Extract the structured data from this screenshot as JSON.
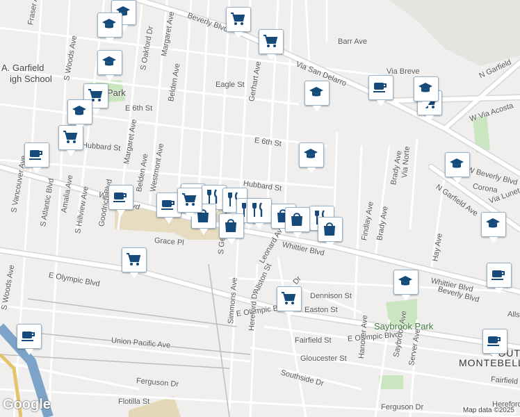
{
  "map": {
    "attribution": "Map data ©2025",
    "logo": "Google",
    "colors": {
      "background": "#f0efee",
      "road": "#ffffff",
      "road_outline": "#d6d6d6",
      "park": "#c9e6c0",
      "school": "#e8dcc0",
      "marker_icon": "#154a7a"
    }
  },
  "streets": [
    "Fraser Ave",
    "S Woods Ave",
    "S Oakford Dr",
    "Margaret Ave",
    "Belden Ave",
    "Gerhart Ave",
    "Beverly Blvd",
    "Barr Ave",
    "Via San Delarro",
    "Via Breve",
    "N Garfield",
    "Eagle St",
    "E 6th St",
    "E 6th St",
    "Hubbard St",
    "Hubbard St",
    "W Via Acosta",
    "Brady Ave",
    "Via Norte",
    "W Beverly Blvd",
    "Corona",
    "N Garfield Ave",
    "Via Luneta",
    "Whittier Blvd",
    "Whittier Blvd",
    "Whittier Blvd",
    "Findlay Ave",
    "Brady Ave",
    "Hay Ave",
    "Grace Pl",
    "Leonard Ave",
    "E Olympic Blvd",
    "E Olympic Blvd",
    "E Olympic Blvd",
    "S Gerhart Ave",
    "Allston St",
    "Dennison St",
    "Easton St",
    "Simmons Ave",
    "Hereford Dr",
    "Union Pacific Ave",
    "Fairfield St",
    "Gloucester St",
    "Southside Dr",
    "Hanover Ave",
    "Saybrook Ave",
    "Server Ave",
    "Ferguson Dr",
    "Ferguson Dr",
    "Flotilla St",
    "S Vancouver Ave",
    "S Atlantic Blvd",
    "Amalia Ave",
    "S Hillview Ave",
    "Goodrich Blvd",
    "Beverly Blvd",
    "Margaret Ave",
    "Belden Ave",
    "Westmont Ave",
    "Fairfield",
    "Hereford Dr",
    "Allston St",
    "S Woods Ave",
    "Dr"
  ],
  "places": [
    "A. Garfield",
    "igh School",
    "Park",
    "Saybrook Park",
    "SOUTH",
    "MONTEBELL"
  ],
  "markers": [
    {
      "icon": "school"
    },
    {
      "icon": "grocery"
    },
    {
      "icon": "school"
    },
    {
      "icon": "grocery"
    },
    {
      "icon": "school"
    },
    {
      "icon": "grocery"
    },
    {
      "icon": "school"
    },
    {
      "icon": "grocery"
    },
    {
      "icon": "cafe"
    },
    {
      "icon": "grocery"
    },
    {
      "icon": "school"
    },
    {
      "icon": "cafe"
    },
    {
      "icon": "school"
    },
    {
      "icon": "cafe"
    },
    {
      "icon": "cafe"
    },
    {
      "icon": "grocery"
    },
    {
      "icon": "restaurant"
    },
    {
      "icon": "restaurant"
    },
    {
      "icon": "restaurant"
    },
    {
      "icon": "shopping"
    },
    {
      "icon": "restaurant"
    },
    {
      "icon": "shopping"
    },
    {
      "icon": "shopping"
    },
    {
      "icon": "restaurant"
    },
    {
      "icon": "shopping"
    },
    {
      "icon": "shopping"
    },
    {
      "icon": "grocery"
    },
    {
      "icon": "grocery"
    },
    {
      "icon": "school"
    },
    {
      "icon": "cafe"
    },
    {
      "icon": "school"
    },
    {
      "icon": "cafe"
    },
    {
      "icon": "cafe"
    },
    {
      "icon": "school"
    },
    {
      "icon": "grocery"
    },
    {
      "icon": "school"
    }
  ]
}
